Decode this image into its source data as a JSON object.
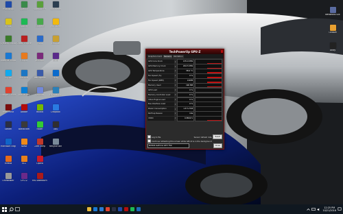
{
  "desktop_icons": [
    {
      "label": "Photoshop",
      "color": "#1f4aa8"
    },
    {
      "label": "Fraps",
      "color": "#d8c31a"
    },
    {
      "label": "System Explorer",
      "color": "#3a7a2a"
    },
    {
      "label": "Internet Explorer",
      "color": "#1a78d2"
    },
    {
      "label": "Skype",
      "color": "#11aaee"
    },
    {
      "label": "Google Chrome",
      "color": "#e0422f"
    },
    {
      "label": "Free Music",
      "color": "#7a0e0e"
    },
    {
      "label": "Steam",
      "color": "#2a2f44"
    },
    {
      "label": "Microsoft Edge",
      "color": "#1064c8"
    },
    {
      "label": "Firefox",
      "color": "#e56a1a"
    },
    {
      "label": "Uninstaller",
      "color": "#999999"
    },
    {
      "label": "Speccy",
      "color": "#3a8a4a"
    },
    {
      "label": "Spotify",
      "color": "#1db954"
    },
    {
      "label": "Cheat Engine",
      "color": "#b82020"
    },
    {
      "label": "Origin",
      "color": "#e87a1e"
    },
    {
      "label": "Recuva",
      "color": "#1b76c4"
    },
    {
      "label": "Battle.net",
      "color": "#0b7fd4"
    },
    {
      "label": "Adobe",
      "color": "#b30b0b"
    },
    {
      "label": "Bandicam",
      "color": "#3a3a3a"
    },
    {
      "label": "Avast",
      "color": "#f08a1a"
    },
    {
      "label": "VLC",
      "color": "#e8801b"
    },
    {
      "label": "CPU-Z",
      "color": "#6a2a8a"
    },
    {
      "label": "Notepad++",
      "color": "#5aa03a"
    },
    {
      "label": "uTorrent",
      "color": "#47a84a"
    },
    {
      "label": "Paint",
      "color": "#2a6ac8"
    },
    {
      "label": "WinRAR",
      "color": "#7a2a7a"
    },
    {
      "label": "Teamspeak",
      "color": "#3a5aa8"
    },
    {
      "label": "Discord",
      "color": "#7289da"
    },
    {
      "label": "Nvidia",
      "color": "#76b900"
    },
    {
      "label": "Razer",
      "color": "#33cc33"
    },
    {
      "label": "Core Temp",
      "color": "#c0392b"
    },
    {
      "label": "Opera",
      "color": "#cc1b2a"
    },
    {
      "label": "MSI Afterburner",
      "color": "#aa1a1a"
    },
    {
      "label": "Rainmeter",
      "color": "#2c3e50"
    },
    {
      "label": "Rockstar",
      "color": "#f2b90c"
    },
    {
      "label": "League",
      "color": "#c8a032"
    },
    {
      "label": "GOG",
      "color": "#5a2a8a"
    },
    {
      "label": "Uplay",
      "color": "#0a6acc"
    },
    {
      "label": "HWMonitor",
      "color": "#2a80b9"
    },
    {
      "label": "Dropbox",
      "color": "#2a7ae2"
    },
    {
      "label": "OBS",
      "color": "#302e31"
    },
    {
      "label": "Recycle Bin",
      "color": "#7a8a9a"
    }
  ],
  "right_icons": [
    {
      "label": "NetBeans IDE",
      "color": "#5a6ba0"
    },
    {
      "label": "Octave",
      "color": "#e8a030"
    },
    {
      "label": "Unity",
      "color": "#222222"
    }
  ],
  "gpuz": {
    "title": "TechPowerUp GPU-Z",
    "tabs": [
      "Graphics Card",
      "Sensors",
      "Validation"
    ],
    "sensors": [
      {
        "name": "GPU Core Clock",
        "value": "135.0 MHz",
        "level": 0.1
      },
      {
        "name": "GPU Memory Clock",
        "value": "202.5 MHz",
        "level": 0.1
      },
      {
        "name": "GPU Temperature",
        "value": "38.0 °C",
        "level": 0.3
      },
      {
        "name": "Fan Speed (%)",
        "value": "0 %",
        "level": 0.35
      },
      {
        "name": "Fan Speed (RPM)",
        "value": "0 RPM",
        "level": 0.35
      },
      {
        "name": "Memory Used",
        "value": "190 MB",
        "level": 0.25
      },
      {
        "name": "GPU Load",
        "value": "0 %",
        "level": 0.0
      },
      {
        "name": "Memory Controller Load",
        "value": "0 %",
        "level": 0.0
      },
      {
        "name": "Video Engine Load",
        "value": "0 %",
        "level": 0.0
      },
      {
        "name": "Bus Interface Load",
        "value": "0 %",
        "level": 0.0
      },
      {
        "name": "Power Consumption",
        "value": "1.8 % TDP",
        "level": 0.05
      },
      {
        "name": "PerfCap Reason",
        "value": "Idle",
        "level": 0.0
      },
      {
        "name": "VDDC",
        "value": "0.8500 V",
        "level": 0.2
      }
    ],
    "log_to_file": "Log to file",
    "continue_refresh": "Continue refreshing this screen while GPU-Z is in the background",
    "sensor_refresh": "Sensor refresh rate",
    "reset_label": "Reset",
    "gpu_select": "NVIDIA GeForce GTX 750",
    "close_label": "Close"
  },
  "taskbar": {
    "pinned": [
      {
        "name": "file-explorer",
        "color": "#e8b93a"
      },
      {
        "name": "edge",
        "color": "#1a78d2"
      },
      {
        "name": "store",
        "color": "#2a7ad2"
      },
      {
        "name": "chrome",
        "color": "#e0422f"
      },
      {
        "name": "steam",
        "color": "#2a2f44"
      },
      {
        "name": "photoshop",
        "color": "#1f4aa8"
      },
      {
        "name": "gpuz",
        "color": "#b30d0d"
      },
      {
        "name": "spotify",
        "color": "#1db954"
      },
      {
        "name": "mail",
        "color": "#1a6ab8"
      }
    ],
    "time": "12:25 PM",
    "date": "10/21/2016"
  }
}
